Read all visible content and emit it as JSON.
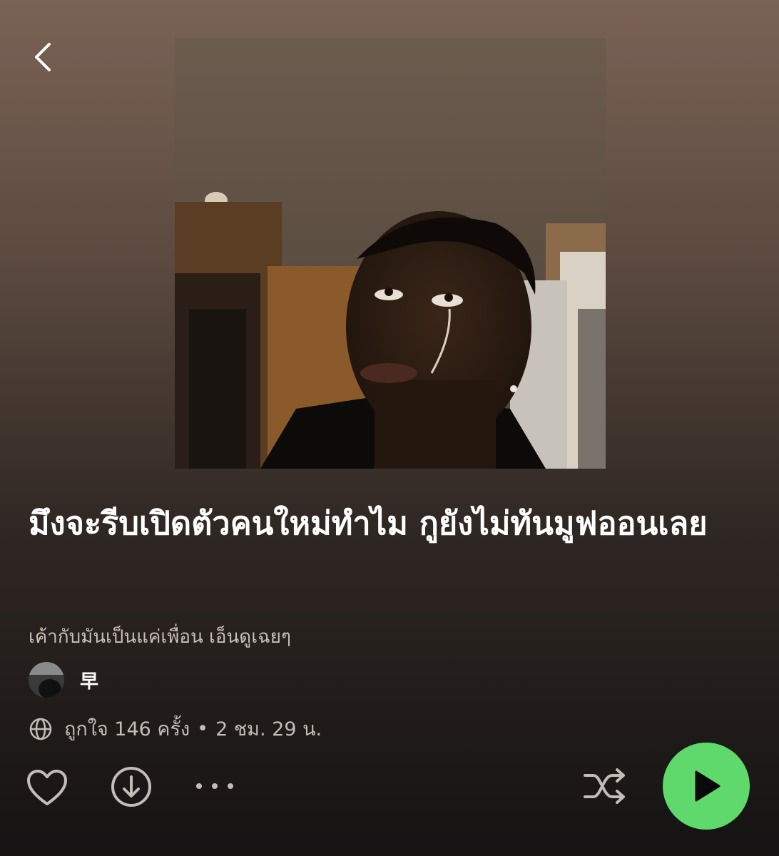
{
  "header": {
    "back_icon": "chevron-left-icon"
  },
  "playlist": {
    "title": "มึงจะรีบเปิดตัวคนใหม่ทำไม กูยังไม่ทันมูฟออนเลย",
    "description": "เค้ากับมันเป็นแค่เพื่อน เอ็นดูเฉยๆ",
    "owner_name": "早",
    "likes_text": "ถูกใจ 146 ครั้ง",
    "separator": "•",
    "duration": "2 ชม. 29 น."
  },
  "actions": {
    "like_icon": "heart-icon",
    "download_icon": "download-icon",
    "more_icon": "more-icon",
    "shuffle_icon": "shuffle-icon",
    "play_icon": "play-icon"
  },
  "colors": {
    "accent": "#5fd96b",
    "muted_text": "#c4bcb6"
  }
}
